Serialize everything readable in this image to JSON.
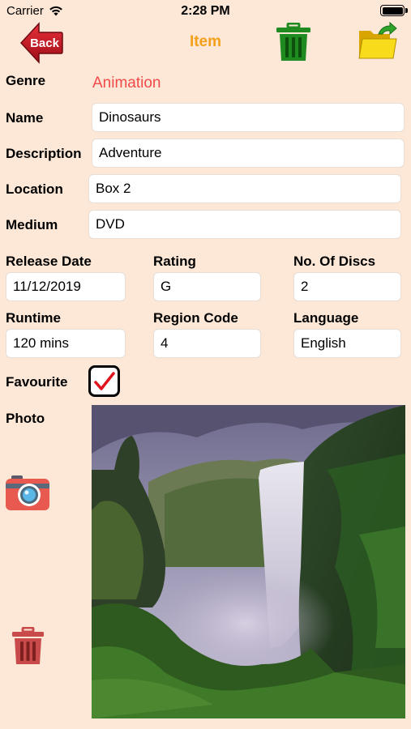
{
  "status_bar": {
    "carrier": "Carrier",
    "time": "2:28 PM"
  },
  "nav": {
    "back_label": "Back",
    "title": "Item"
  },
  "form": {
    "genre": {
      "label": "Genre",
      "value": "Animation"
    },
    "name": {
      "label": "Name",
      "value": "Dinosaurs"
    },
    "description": {
      "label": "Description",
      "value": "Adventure"
    },
    "location": {
      "label": "Location",
      "value": "Box 2"
    },
    "medium": {
      "label": "Medium",
      "value": "DVD"
    },
    "release_date": {
      "label": "Release Date",
      "value": "11/12/2019"
    },
    "rating": {
      "label": "Rating",
      "value": "G"
    },
    "num_discs": {
      "label": "No. Of Discs",
      "value": "2"
    },
    "runtime": {
      "label": "Runtime",
      "value": "120 mins"
    },
    "region_code": {
      "label": "Region Code",
      "value": "4"
    },
    "language": {
      "label": "Language",
      "value": "English"
    },
    "favourite": {
      "label": "Favourite",
      "checked": true
    },
    "photo": {
      "label": "Photo"
    }
  },
  "icons": {
    "back": "back-arrow-icon",
    "delete": "trash-icon",
    "open": "folder-open-icon",
    "camera": "camera-icon",
    "check": "checkmark-icon"
  },
  "colors": {
    "background": "#fde7d6",
    "title": "#f5a01a",
    "genre": "#f04a4a",
    "trash_top": "#1f8a1f",
    "trash_bottom": "#c94a4a"
  }
}
